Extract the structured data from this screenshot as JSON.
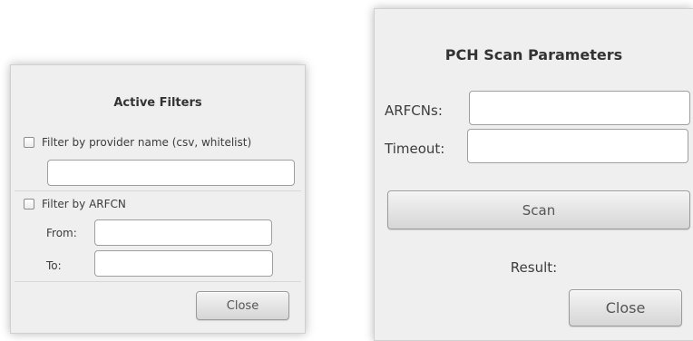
{
  "filters_dialog": {
    "title": "Active Filters",
    "provider_filter": {
      "label": "Filter by provider name (csv, whitelist)",
      "checked": false,
      "value": ""
    },
    "arfcn_filter": {
      "label": "Filter by ARFCN",
      "checked": false,
      "from_label": "From:",
      "from_value": "",
      "to_label": "To:",
      "to_value": ""
    },
    "close_label": "Close"
  },
  "pch_dialog": {
    "title": "PCH Scan Parameters",
    "arfcns_label": "ARFCNs:",
    "arfcns_value": "",
    "timeout_label": "Timeout:",
    "timeout_value": "",
    "scan_label": "Scan",
    "result_label": "Result:",
    "close_label": "Close"
  }
}
